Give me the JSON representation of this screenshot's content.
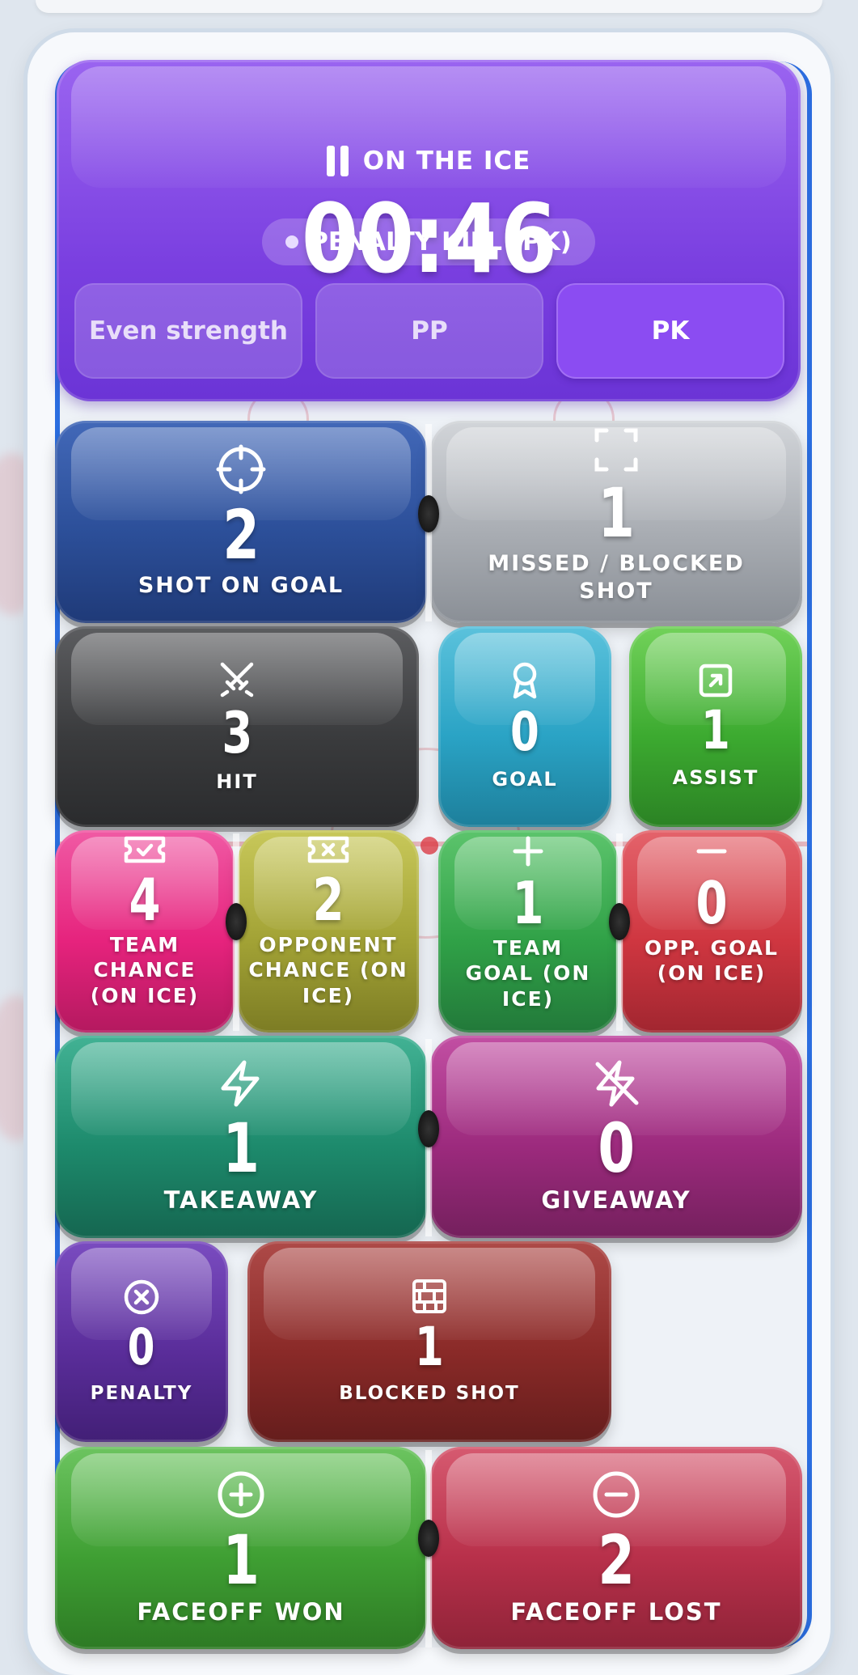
{
  "header": {
    "status": "ON THE ICE",
    "timer": "00:46",
    "mode": "PENALTY KILL (PK)",
    "segments": [
      "Even strength",
      "PP",
      "PK"
    ],
    "active_segment": "PK"
  },
  "tiles": {
    "shot_on_goal": {
      "count": "2",
      "label": "SHOT ON GOAL",
      "color": "#2c4f99"
    },
    "missed_blocked_shot": {
      "count": "1",
      "label": "MISSED / BLOCKED SHOT",
      "color": "#a9adb3"
    },
    "hit": {
      "count": "3",
      "label": "HIT",
      "color": "#3a3b3d"
    },
    "goal": {
      "count": "0",
      "label": "GOAL",
      "color": "#2aa3c5"
    },
    "assist": {
      "count": "1",
      "label": "ASSIST",
      "color": "#3caa30"
    },
    "team_chance": {
      "count": "4",
      "label": "TEAM CHANCE (ON ICE)",
      "color": "#e6237d"
    },
    "opponent_chance": {
      "count": "2",
      "label": "OPPONENT CHANCE (ON ICE)",
      "color": "#a2a235"
    },
    "team_goal": {
      "count": "1",
      "label": "TEAM GOAL (ON ICE)",
      "color": "#30a147"
    },
    "opp_goal": {
      "count": "0",
      "label": "OPP. GOAL (ON ICE)",
      "color": "#cf3640"
    },
    "takeaway": {
      "count": "1",
      "label": "TAKEAWAY",
      "color": "#1d8a6c"
    },
    "giveaway": {
      "count": "0",
      "label": "GIVEAWAY",
      "color": "#9c2a7d"
    },
    "penalty": {
      "count": "0",
      "label": "PENALTY",
      "color": "#5a2d9a"
    },
    "blocked_shot": {
      "count": "1",
      "label": "BLOCKED SHOT",
      "color": "#8a2a28"
    },
    "faceoff_won": {
      "count": "1",
      "label": "FACEOFF WON",
      "color": "#3f9f33"
    },
    "faceoff_lost": {
      "count": "2",
      "label": "FACEOFF LOST",
      "color": "#b8304a"
    }
  },
  "icons": {
    "shot_on_goal": "crosshair-icon",
    "missed_blocked_shot": "focus-frame-icon",
    "hit": "crossed-swords-icon",
    "goal": "award-icon",
    "assist": "arrow-up-right-square-icon",
    "team_chance": "ticket-check-icon",
    "opponent_chance": "ticket-x-icon",
    "team_goal": "plus-icon",
    "opp_goal": "minus-icon",
    "takeaway": "lightning-icon",
    "giveaway": "lightning-off-icon",
    "penalty": "x-circle-icon",
    "blocked_shot": "brick-wall-icon",
    "faceoff_won": "plus-circle-icon",
    "faceoff_lost": "minus-circle-icon"
  }
}
